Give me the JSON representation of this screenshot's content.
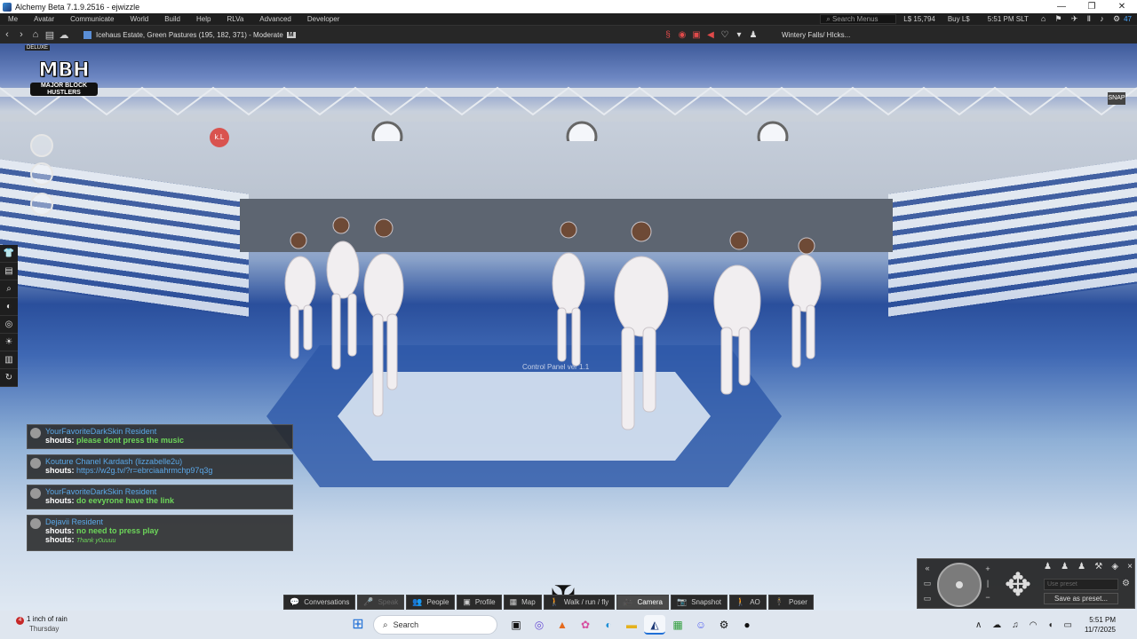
{
  "window": {
    "title": "Alchemy Beta 7.1.9.2516 - ejwizzle",
    "controls": [
      "—",
      "❐",
      "✕"
    ]
  },
  "menubar": {
    "items": [
      "Me",
      "Avatar",
      "Communicate",
      "World",
      "Build",
      "Help",
      "RLVa",
      "Advanced",
      "Developer"
    ],
    "search_placeholder": "Search Menus",
    "balance": "L$ 15,794",
    "buy": "Buy L$",
    "time": "5:51 PM SLT",
    "fps": "47"
  },
  "navbar": {
    "location": "Icehaus Estate, Green Pastures (195, 182, 371) - Moderate",
    "rating": "M",
    "parcel_media": "Wintery Falls/ HIcks..."
  },
  "scene": {
    "logo_text": "MBH",
    "logo_sub": "MAJOR BLOCK HUSTLERS",
    "logo_tag": "DELUXE",
    "floating_text": "Control Panel ver 1.1",
    "snapshot_hud": "SNAP",
    "hud_red_label": "k.L"
  },
  "chat": [
    {
      "name": "YourFavoriteDarkSkin Resident",
      "lines": [
        {
          "label": "shouts:",
          "text": "please dont press the music",
          "type": "msg"
        }
      ]
    },
    {
      "name": "Kouture Chanel Kardash (lizzabelle2u)",
      "lines": [
        {
          "label": "shouts:",
          "text": "https://w2g.tv/?r=ebrciaahrmchp97q3g",
          "type": "link"
        }
      ]
    },
    {
      "name": "YourFavoriteDarkSkin Resident",
      "lines": [
        {
          "label": "shouts:",
          "text": "do eevyrone have the link",
          "type": "msg"
        }
      ]
    },
    {
      "name": "Dejavii Resident",
      "lines": [
        {
          "label": "shouts:",
          "text": "no need to press play",
          "type": "msg"
        },
        {
          "label": "shouts:",
          "text": "Thank y0uuuu",
          "type": "hand"
        }
      ]
    }
  ],
  "toolbar": {
    "buttons": [
      {
        "label": "Conversations",
        "icon": "💬",
        "state": "normal"
      },
      {
        "label": "Speak",
        "icon": "🎤",
        "state": "dim"
      },
      {
        "label": "People",
        "icon": "👥",
        "state": "normal"
      },
      {
        "label": "Profile",
        "icon": "▣",
        "state": "normal"
      },
      {
        "label": "Map",
        "icon": "▦",
        "state": "normal"
      },
      {
        "label": "Walk / run / fly",
        "icon": "🚶",
        "state": "normal"
      },
      {
        "label": "Camera",
        "icon": "🎥",
        "state": "active"
      },
      {
        "label": "Snapshot",
        "icon": "📷",
        "state": "normal"
      },
      {
        "label": "AO",
        "icon": "🚶",
        "state": "normal"
      },
      {
        "label": "Poser",
        "icon": "🕴",
        "state": "normal"
      }
    ]
  },
  "camera": {
    "use_preset_placeholder": "Use preset",
    "save_label": "Save as preset..."
  },
  "taskbar": {
    "weather_badge": "4",
    "weather_text": "1 inch of rain",
    "weather_day": "Thursday",
    "search_label": "Search",
    "clock_time": "5:51 PM",
    "clock_date": "11/7/2025"
  }
}
